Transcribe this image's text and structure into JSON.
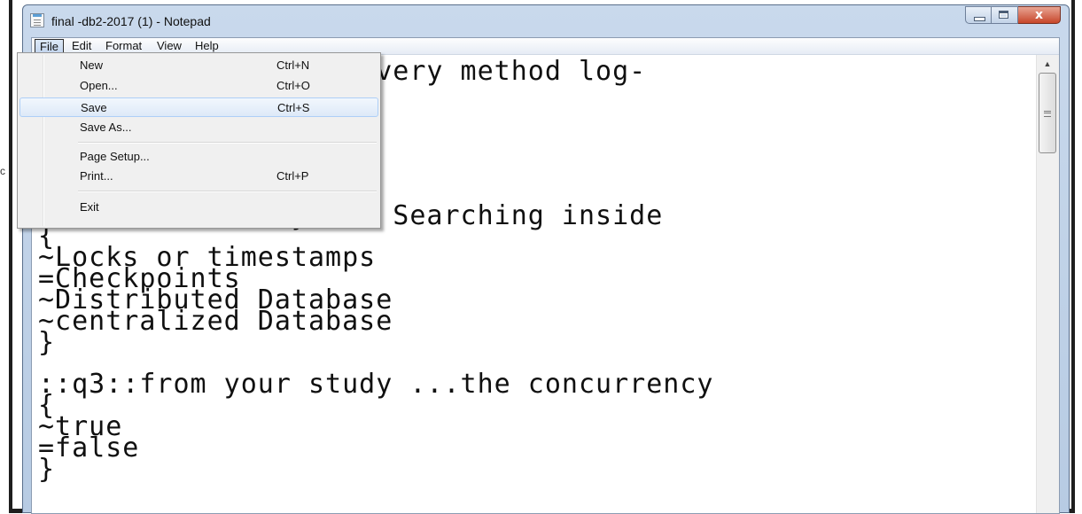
{
  "window": {
    "title": "final -db2-2017 (1) - Notepad",
    "close_glyph": "x",
    "icon": "notepad-icon"
  },
  "menubar": {
    "items": [
      "File",
      "Edit",
      "Format",
      "View",
      "Help"
    ],
    "active": "File"
  },
  "file_menu": {
    "items": [
      {
        "label": "New",
        "shortcut": "Ctrl+N"
      },
      {
        "label": "Open...",
        "shortcut": "Ctrl+O"
      },
      {
        "label": "Save",
        "shortcut": "Ctrl+S"
      },
      {
        "label": "Save As...",
        "shortcut": ""
      },
      {
        "label": "Page Setup...",
        "shortcut": ""
      },
      {
        "label": "Print...",
        "shortcut": "Ctrl+P"
      },
      {
        "label": "Exit",
        "shortcut": ""
      }
    ],
    "highlighted": "Save"
  },
  "editor": {
    "lines": [
      "          s one recovery method log-",
      "",
      "",
      "",
      "",
      "          covery the Searching inside",
      "{",
      "~Locks or timestamps",
      "=Checkpoints",
      "~Distributed Database",
      "~centralized Database",
      "}",
      "",
      "::q3::from your study ...the concurrency",
      "{",
      "~true",
      "=false",
      "}"
    ]
  },
  "background": {
    "fragment": "c"
  },
  "colors": {
    "titlebar": "#c9d9ec",
    "close_button": "#c7462a",
    "menu_highlight": "#aecff7"
  }
}
